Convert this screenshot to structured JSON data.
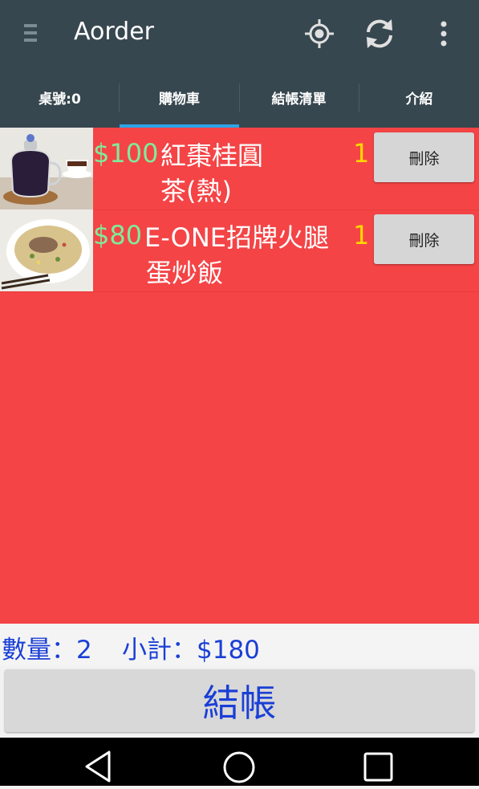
{
  "app": {
    "title": "Aorder"
  },
  "toolbar": {
    "menu_icon": "menu-icon",
    "actions": [
      "location-target-icon",
      "refresh-icon",
      "more-vert-icon"
    ]
  },
  "tabs": [
    {
      "label": "桌號:0",
      "selected": false
    },
    {
      "label": "購物車",
      "selected": true
    },
    {
      "label": "結帳清單",
      "selected": false
    },
    {
      "label": "介紹",
      "selected": false
    }
  ],
  "cart": {
    "items": [
      {
        "image": "tea-pot-photo",
        "price": "$100",
        "name": "紅棗桂圓\n茶(熱)",
        "qty": "1",
        "delete_label": "刪除"
      },
      {
        "image": "fried-rice-photo",
        "price": "$80",
        "name": "E-ONE招牌火腿\n蛋炒飯",
        "qty": "1",
        "delete_label": "刪除"
      }
    ]
  },
  "summary": {
    "count_text": "數量：2",
    "subtotal_text": "小計：$180"
  },
  "checkout_label": "結帳",
  "colors": {
    "appbar": "#37474f",
    "tab_indicator": "#2ea3e6",
    "list_bg": "#f44446",
    "price": "#7fec9b",
    "qty": "#ffd700",
    "summary_text": "#1a3fd6"
  },
  "navbar": {
    "buttons": [
      "back-icon",
      "home-icon",
      "recents-icon"
    ]
  }
}
